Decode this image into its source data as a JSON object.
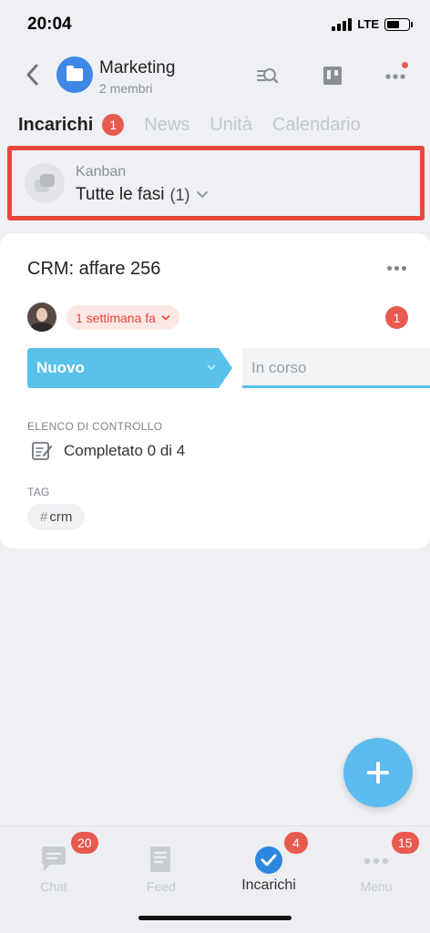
{
  "status_bar": {
    "time": "20:04",
    "network": "LTE"
  },
  "header": {
    "title": "Marketing",
    "subtitle": "2 membri"
  },
  "tabs": [
    {
      "label": "Incarichi",
      "badge": "1",
      "active": true
    },
    {
      "label": "News"
    },
    {
      "label": "Unità"
    },
    {
      "label": "Calendario"
    }
  ],
  "kanban": {
    "label": "Kanban",
    "value": "Tutte le fasi",
    "count": "(1)"
  },
  "task_card": {
    "title": "CRM: affare 256",
    "deadline": "1 settimana fa",
    "badge": "1",
    "stage_current": "Nuovo",
    "stage_next": "In corso",
    "checklist_label": "ELENCO DI CONTROLLO",
    "checklist_text": "Completato 0 di 4",
    "tags_label": "TAG",
    "tag": "crm"
  },
  "bottom_nav": [
    {
      "label": "Chat",
      "badge": "20"
    },
    {
      "label": "Feed"
    },
    {
      "label": "Incarichi",
      "badge": "4",
      "active": true
    },
    {
      "label": "Menu",
      "badge": "15"
    }
  ],
  "colors": {
    "accent": "#3f87e5",
    "badge": "#e85a4f",
    "highlight_border": "#e8473b",
    "stage": "#59c1ea"
  }
}
